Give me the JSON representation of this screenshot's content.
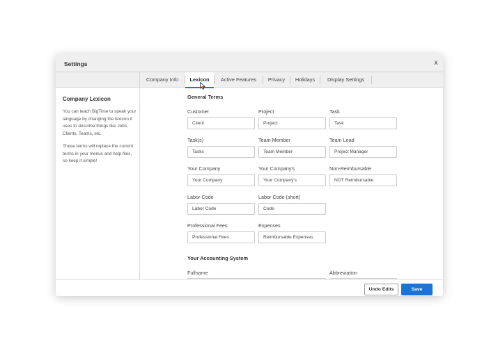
{
  "dialog": {
    "title": "Settings",
    "close_label": "x"
  },
  "tabs": [
    {
      "label": "Company Info"
    },
    {
      "label": "Lexicon"
    },
    {
      "label": "Active Features"
    },
    {
      "label": "Privacy"
    },
    {
      "label": "Holidays"
    },
    {
      "label": "Display Settings"
    }
  ],
  "active_tab": "Lexicon",
  "sidebar": {
    "title": "Company Lexicon",
    "paragraph1": "You can teach BigTime to speak your language by changing the lexicon it uses to describe things like Jobs, Clients, Teams, etc.",
    "paragraph2": "These terms will replace the current terms in your menus and help files, so keep it simple!"
  },
  "general_terms": {
    "title": "General Terms",
    "fields": [
      {
        "label": "Customer",
        "value": "Client"
      },
      {
        "label": "Project",
        "value": "Project"
      },
      {
        "label": "Task",
        "value": "Task"
      },
      {
        "label": "Task(s)",
        "value": "Tasks"
      },
      {
        "label": "Team Member",
        "value": "Team Member"
      },
      {
        "label": "Team Lead",
        "value": "Project Manager"
      },
      {
        "label": "Your Company",
        "value": "Your Company"
      },
      {
        "label": "Your Company's",
        "value": "Your Company's"
      },
      {
        "label": "Non-Reimbursable",
        "value": "NOT Reimbursable"
      },
      {
        "label": "Labor Code",
        "value": "Labor Code"
      },
      {
        "label": "Labor Code (short)",
        "value": "Code"
      },
      {
        "label": "Professional Fees",
        "value": "Professional Fees"
      },
      {
        "label": "Expenses",
        "value": "Reimbursable Expenses"
      }
    ]
  },
  "accounting": {
    "title": "Your Accounting System",
    "fullname_label": "Fullname",
    "abbreviation_label": "Abbreviation"
  },
  "footer": {
    "undo_label": "Undo Edits",
    "save_label": "Save"
  },
  "colors": {
    "accent": "#1a73d9",
    "header_bg": "#efefef"
  }
}
